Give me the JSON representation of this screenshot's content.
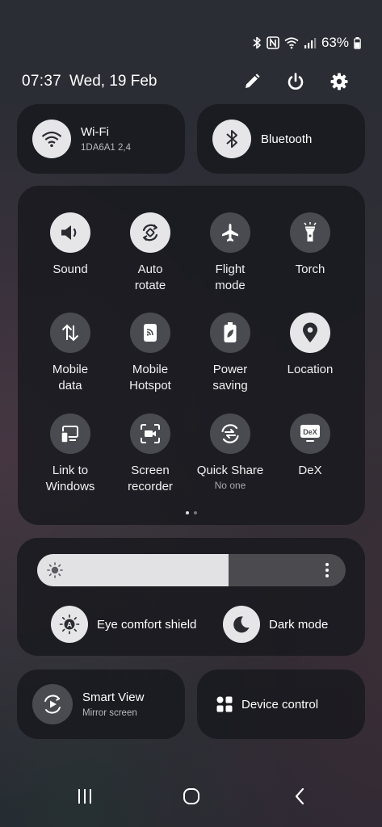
{
  "status_bar": {
    "battery": "63%"
  },
  "header": {
    "time": "07:37",
    "date": "Wed, 19 Feb"
  },
  "wifi": {
    "label": "Wi-Fi",
    "network": "1DA6A1 2,4"
  },
  "bluetooth": {
    "label": "Bluetooth"
  },
  "tiles": [
    {
      "label": "Sound",
      "icon": "speaker-icon",
      "state": "on"
    },
    {
      "label": "Auto\nrotate",
      "icon": "auto-rotate-icon",
      "state": "on"
    },
    {
      "label": "Flight\nmode",
      "icon": "airplane-icon",
      "state": "off"
    },
    {
      "label": "Torch",
      "icon": "torch-icon",
      "state": "off"
    },
    {
      "label": "Mobile\ndata",
      "icon": "mobile-data-icon",
      "state": "off"
    },
    {
      "label": "Mobile\nHotspot",
      "icon": "hotspot-icon",
      "state": "off"
    },
    {
      "label": "Power\nsaving",
      "icon": "power-saving-icon",
      "state": "off"
    },
    {
      "label": "Location",
      "icon": "location-icon",
      "state": "on"
    },
    {
      "label": "Link to\nWindows",
      "icon": "link-windows-icon",
      "state": "off"
    },
    {
      "label": "Screen\nrecorder",
      "icon": "screen-recorder-icon",
      "state": "off"
    },
    {
      "label": "Quick Share",
      "sub": "No one",
      "icon": "quick-share-icon",
      "state": "off"
    },
    {
      "label": "DeX",
      "icon": "dex-icon",
      "state": "off"
    }
  ],
  "brightness": {
    "level": 0.62
  },
  "eye_comfort": {
    "label": "Eye comfort shield"
  },
  "dark_mode": {
    "label": "Dark mode"
  },
  "smart_view": {
    "label": "Smart View",
    "sub": "Mirror screen"
  },
  "device_control": {
    "label": "Device control"
  },
  "colors": {
    "on_circle": "#e6e6e8",
    "off_circle": "#4a4b50",
    "card_bg": "#16171c"
  }
}
